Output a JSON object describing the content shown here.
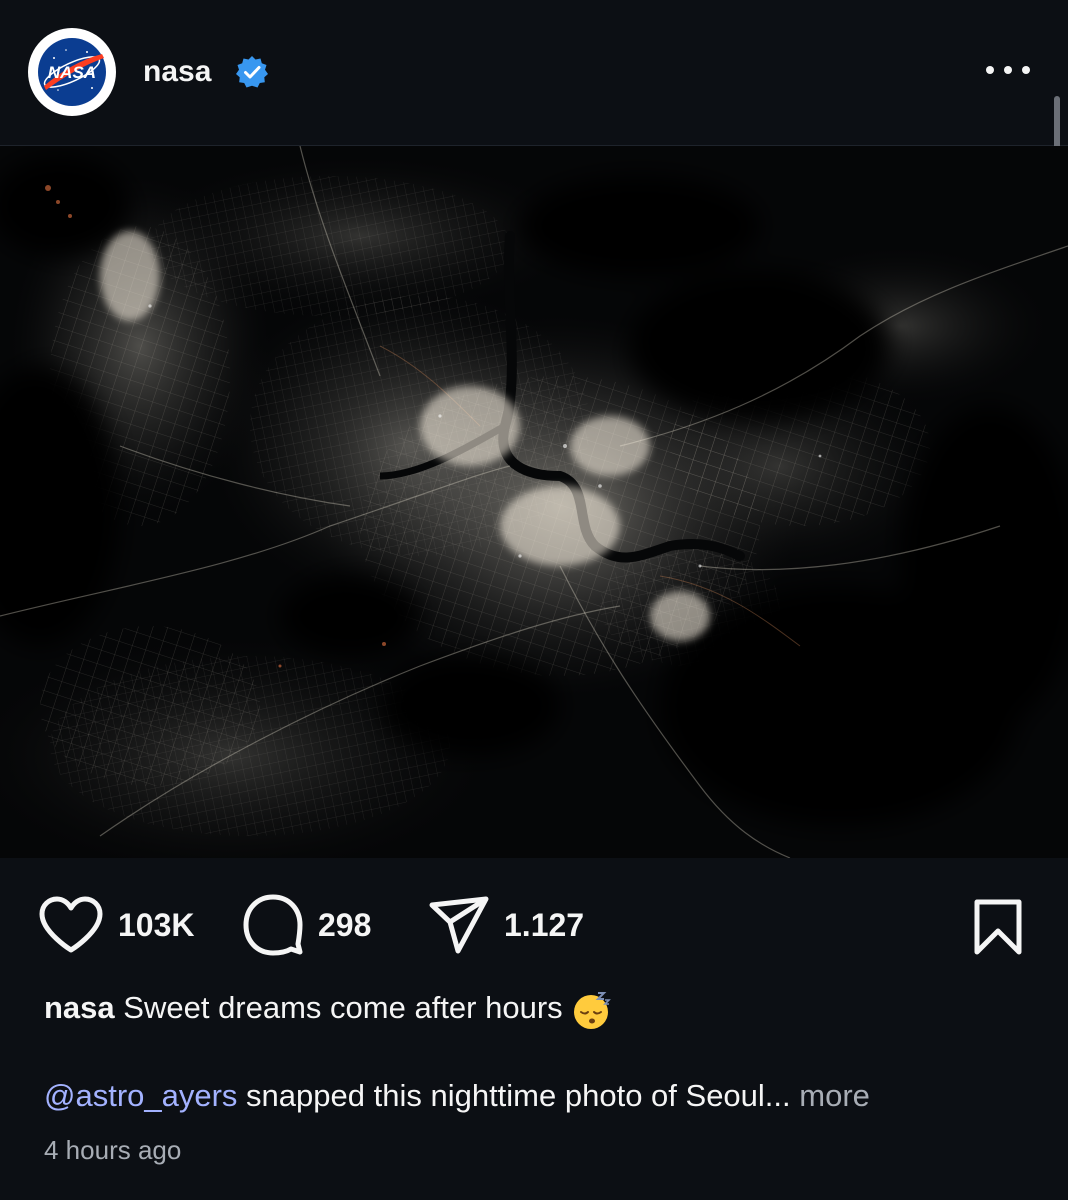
{
  "post": {
    "username": "nasa",
    "avatar_label": "NASA",
    "verified_icon": "verified-badge-icon",
    "more_icon": "more-options-icon"
  },
  "photo": {
    "alt": "Nighttime photo of Seoul from space"
  },
  "actions": {
    "likes": "103K",
    "comments": "298",
    "shares": "1.127",
    "like_icon": "heart-icon",
    "comment_icon": "comment-bubble-icon",
    "share_icon": "paper-plane-icon",
    "save_icon": "bookmark-icon"
  },
  "caption": {
    "username": "nasa",
    "text": "Sweet dreams come after hours",
    "emoji": "sleeping-face-emoji",
    "mention": "@astro_ayers",
    "continuation": " snapped this nighttime photo of Seoul...",
    "more_label": "more"
  },
  "timestamp": "4 hours ago",
  "colors": {
    "background": "#0c0f14",
    "text": "#f5f5f5",
    "verified": "#3897f0",
    "mention": "#a3b2ff",
    "secondary": "#a8adb5"
  }
}
